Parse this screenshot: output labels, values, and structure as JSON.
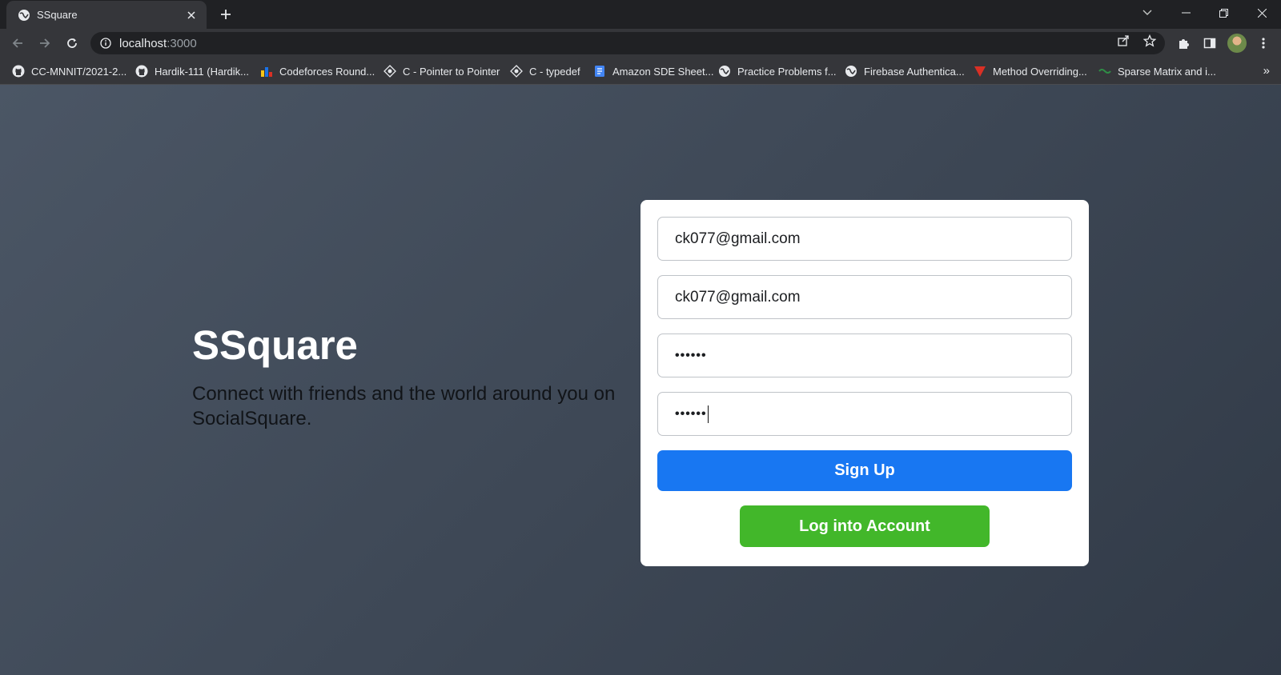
{
  "browser": {
    "tab_title": "SSquare",
    "url_host": "localhost",
    "url_path": ":3000",
    "bookmarks": [
      {
        "label": "CC-MNNIT/2021-2...",
        "icon": "github-icon"
      },
      {
        "label": "Hardik-111 (Hardik...",
        "icon": "github-icon"
      },
      {
        "label": "Codeforces Round...",
        "icon": "codeforces-icon"
      },
      {
        "label": "C - Pointer to Pointer",
        "icon": "site-icon"
      },
      {
        "label": "C - typedef",
        "icon": "site-icon"
      },
      {
        "label": "Amazon SDE Sheet...",
        "icon": "docs-icon"
      },
      {
        "label": "Practice Problems f...",
        "icon": "globe-icon"
      },
      {
        "label": "Firebase Authentica...",
        "icon": "globe-icon"
      },
      {
        "label": "Method Overriding...",
        "icon": "gfg-icon"
      },
      {
        "label": "Sparse Matrix and i...",
        "icon": "geeks-icon"
      }
    ],
    "bookmarks_more": "»"
  },
  "hero": {
    "title": "SSquare",
    "tagline": "Connect with friends and the world around you on SocialSquare."
  },
  "form": {
    "email": "ck077@gmail.com",
    "confirm_email": "ck077@gmail.com",
    "password_mask": "••••••",
    "confirm_password_mask": "••••••",
    "signup_label": "Sign Up",
    "login_label": "Log into Account"
  },
  "colors": {
    "primary": "#1877f2",
    "success": "#42b72a",
    "chrome_dark": "#202124",
    "chrome": "#35363a"
  }
}
